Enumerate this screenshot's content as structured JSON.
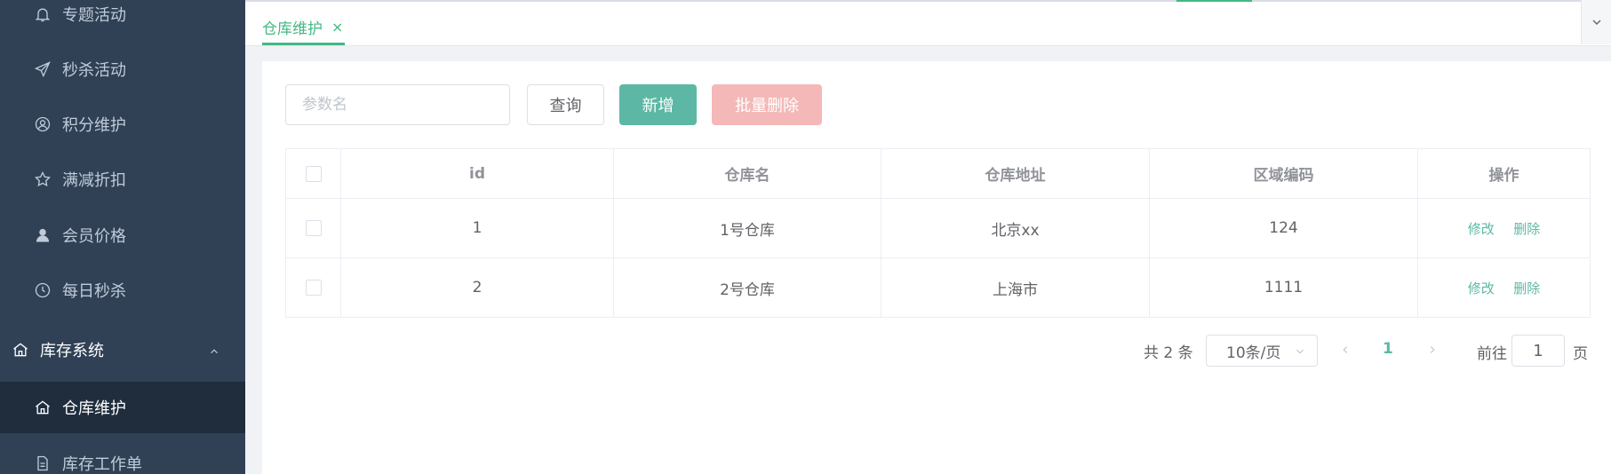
{
  "sidebar": {
    "items": [
      {
        "label": "专题活动",
        "icon": "bell-icon"
      },
      {
        "label": "秒杀活动",
        "icon": "send-icon"
      },
      {
        "label": "积分维护",
        "icon": "user-circle-icon"
      },
      {
        "label": "满减折扣",
        "icon": "star-icon"
      },
      {
        "label": "会员价格",
        "icon": "user-icon"
      },
      {
        "label": "每日秒杀",
        "icon": "clock-icon"
      }
    ],
    "group": {
      "label": "库存系统",
      "icon": "home-icon"
    },
    "sub_items": [
      {
        "label": "仓库维护",
        "icon": "home-icon",
        "active": true
      },
      {
        "label": "库存工作单",
        "icon": "document-icon"
      }
    ]
  },
  "tabs": [
    {
      "label": "仓库维护",
      "close": "×"
    }
  ],
  "toolbar": {
    "search_placeholder": "参数名",
    "query_label": "查询",
    "add_label": "新增",
    "batch_delete_label": "批量删除"
  },
  "table": {
    "headers": [
      "id",
      "仓库名",
      "仓库地址",
      "区域编码",
      "操作"
    ],
    "rows": [
      {
        "id": "1",
        "name": "1号仓库",
        "address": "北京xx",
        "area": "124"
      },
      {
        "id": "2",
        "name": "2号仓库",
        "address": "上海市",
        "area": "1111"
      }
    ],
    "edit_label": "修改",
    "delete_label": "删除"
  },
  "pagination": {
    "total": "共 2 条",
    "page_size": "10条/页",
    "current": "1",
    "goto": "前往",
    "jump_value": "1",
    "page_unit": "页"
  },
  "colors": {
    "sidebar_bg": "#304156",
    "accent": "#42b983",
    "primary_button": "#5cb8a4",
    "danger_disabled": "#f4b8b8"
  }
}
